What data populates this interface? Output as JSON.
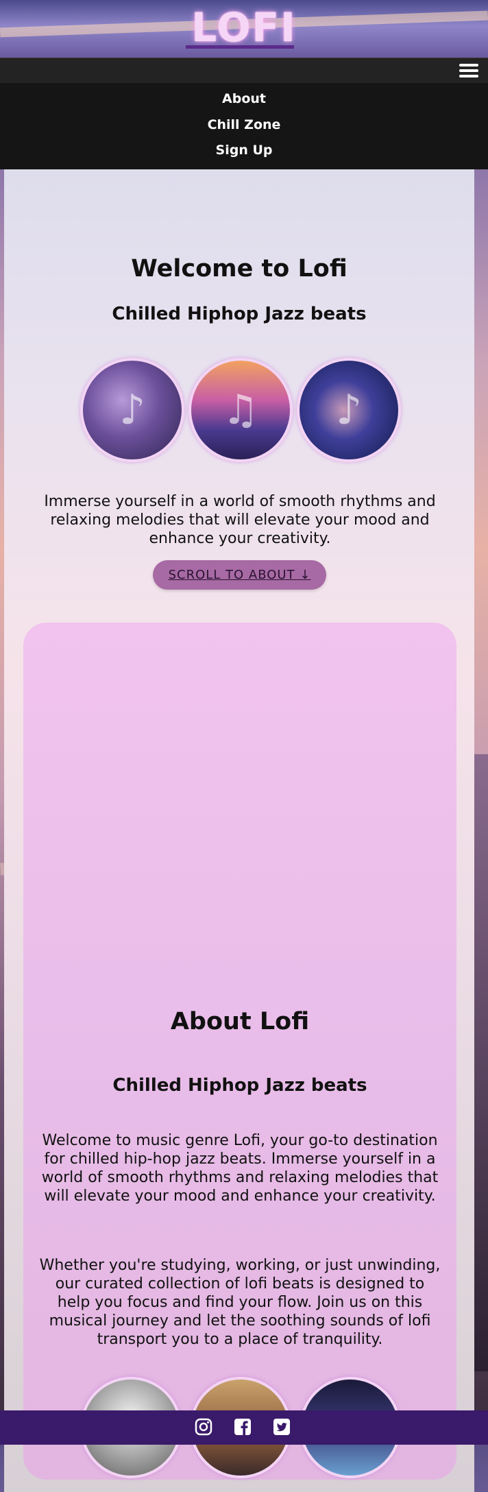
{
  "header": {
    "logo": "LOFI"
  },
  "menu": {
    "icon": "hamburger-menu-icon"
  },
  "nav": {
    "items": [
      {
        "label": "About"
      },
      {
        "label": "Chill Zone"
      },
      {
        "label": "Sign Up"
      }
    ]
  },
  "hero": {
    "title": "Welcome to Lofi",
    "subtitle": "Chilled Hiphop Jazz beats",
    "description": "Immerse yourself in a world of smooth rhythms and relaxing melodies that will elevate your mood and enhance your creativity.",
    "button_label": "SCROLL TO ABOUT ↓"
  },
  "about": {
    "title": "About Lofi",
    "subtitle": "Chilled Hiphop Jazz beats",
    "paragraph1": "Welcome to music genre Lofi, your go-to destination for chilled hip-hop jazz beats. Immerse yourself in a world of smooth rhythms and relaxing melodies that will elevate your mood and enhance your creativity.",
    "paragraph2": "Whether you're studying, working, or just unwinding, our curated collection of lofi beats is designed to help you focus and find your flow. Join us on this musical journey and let the soothing sounds of lofi transport you to a place of tranquility."
  },
  "footer": {
    "icons": [
      "instagram-icon",
      "facebook-icon",
      "twitter-icon"
    ]
  },
  "colors": {
    "accent": "#a76aa4",
    "footer": "#3a1a6a",
    "nav_bg": "#151515"
  }
}
